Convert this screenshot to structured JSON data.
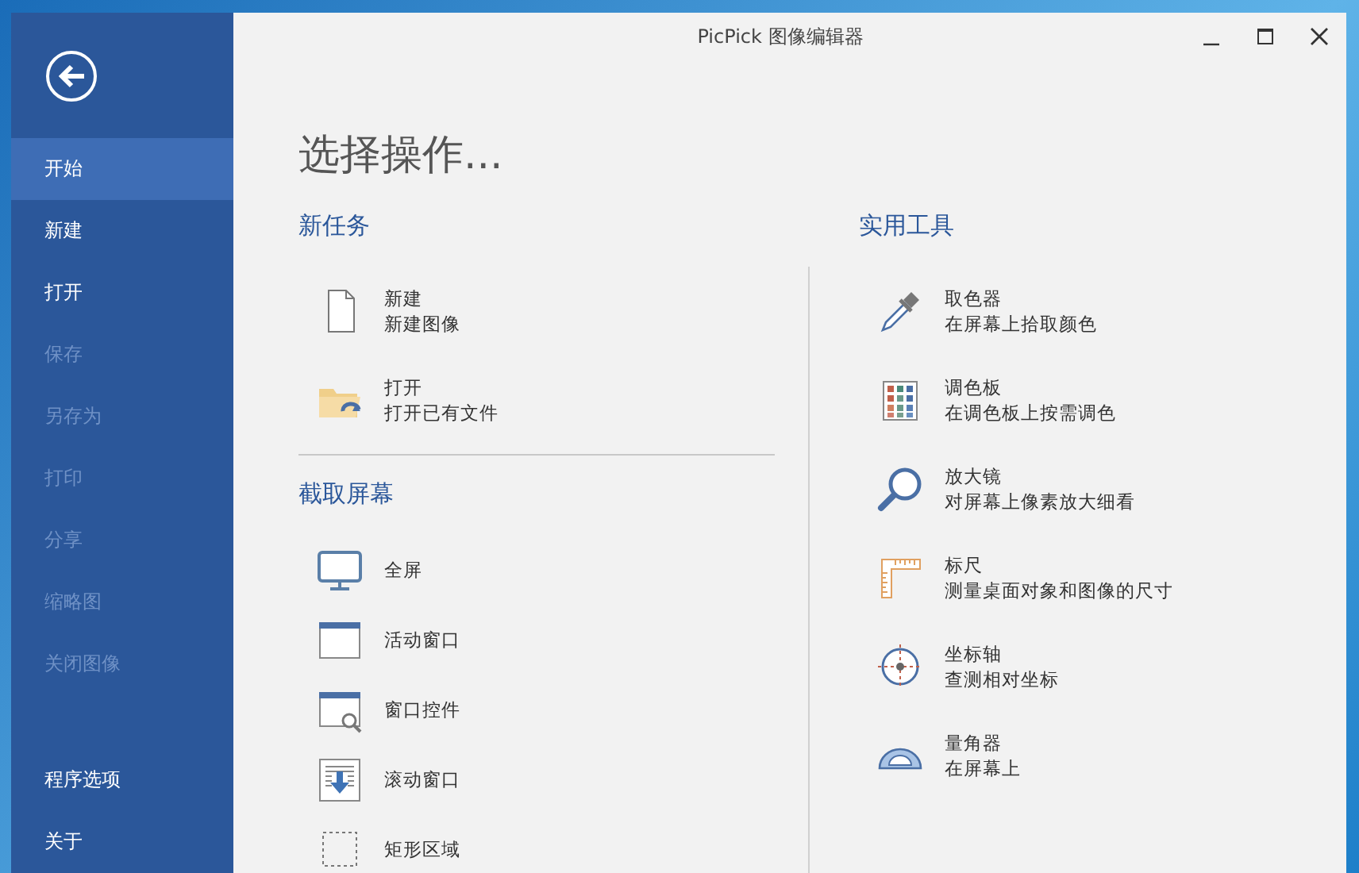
{
  "window": {
    "title": "PicPick 图像编辑器"
  },
  "sidebar": {
    "items": [
      {
        "label": "开始",
        "selected": true,
        "disabled": false
      },
      {
        "label": "新建",
        "selected": false,
        "disabled": false
      },
      {
        "label": "打开",
        "selected": false,
        "disabled": false
      },
      {
        "label": "保存",
        "selected": false,
        "disabled": true
      },
      {
        "label": "另存为",
        "selected": false,
        "disabled": true
      },
      {
        "label": "打印",
        "selected": false,
        "disabled": true
      },
      {
        "label": "分享",
        "selected": false,
        "disabled": true
      },
      {
        "label": "缩略图",
        "selected": false,
        "disabled": true
      },
      {
        "label": "关闭图像",
        "selected": false,
        "disabled": true
      }
    ],
    "footer_items": [
      {
        "label": "程序选项",
        "selected": false,
        "disabled": false
      },
      {
        "label": "关于",
        "selected": false,
        "disabled": false
      }
    ]
  },
  "main": {
    "heading": "选择操作...",
    "new_task": {
      "title": "新任务",
      "items": [
        {
          "kind": "page",
          "label": "新建",
          "description": "新建图像"
        },
        {
          "kind": "folder",
          "label": "打开",
          "description": "打开已有文件"
        }
      ]
    },
    "capture": {
      "title": "截取屏幕",
      "items": [
        {
          "kind": "monitor",
          "label": "全屏"
        },
        {
          "kind": "window",
          "label": "活动窗口"
        },
        {
          "kind": "window-search",
          "label": "窗口控件"
        },
        {
          "kind": "scroll",
          "label": "滚动窗口"
        },
        {
          "kind": "region",
          "label": "矩形区域"
        }
      ]
    },
    "tools": {
      "title": "实用工具",
      "items": [
        {
          "kind": "eyedropper",
          "label": "取色器",
          "description": "在屏幕上拾取颜色"
        },
        {
          "kind": "palette",
          "label": "调色板",
          "description": "在调色板上按需调色"
        },
        {
          "kind": "magnifier",
          "label": "放大镜",
          "description": "对屏幕上像素放大细看"
        },
        {
          "kind": "ruler",
          "label": "标尺",
          "description": "测量桌面对象和图像的尺寸"
        },
        {
          "kind": "crosshair",
          "label": "坐标轴",
          "description": "查测相对坐标"
        },
        {
          "kind": "protractor",
          "label": "量角器",
          "description": "在屏幕上"
        }
      ]
    }
  }
}
